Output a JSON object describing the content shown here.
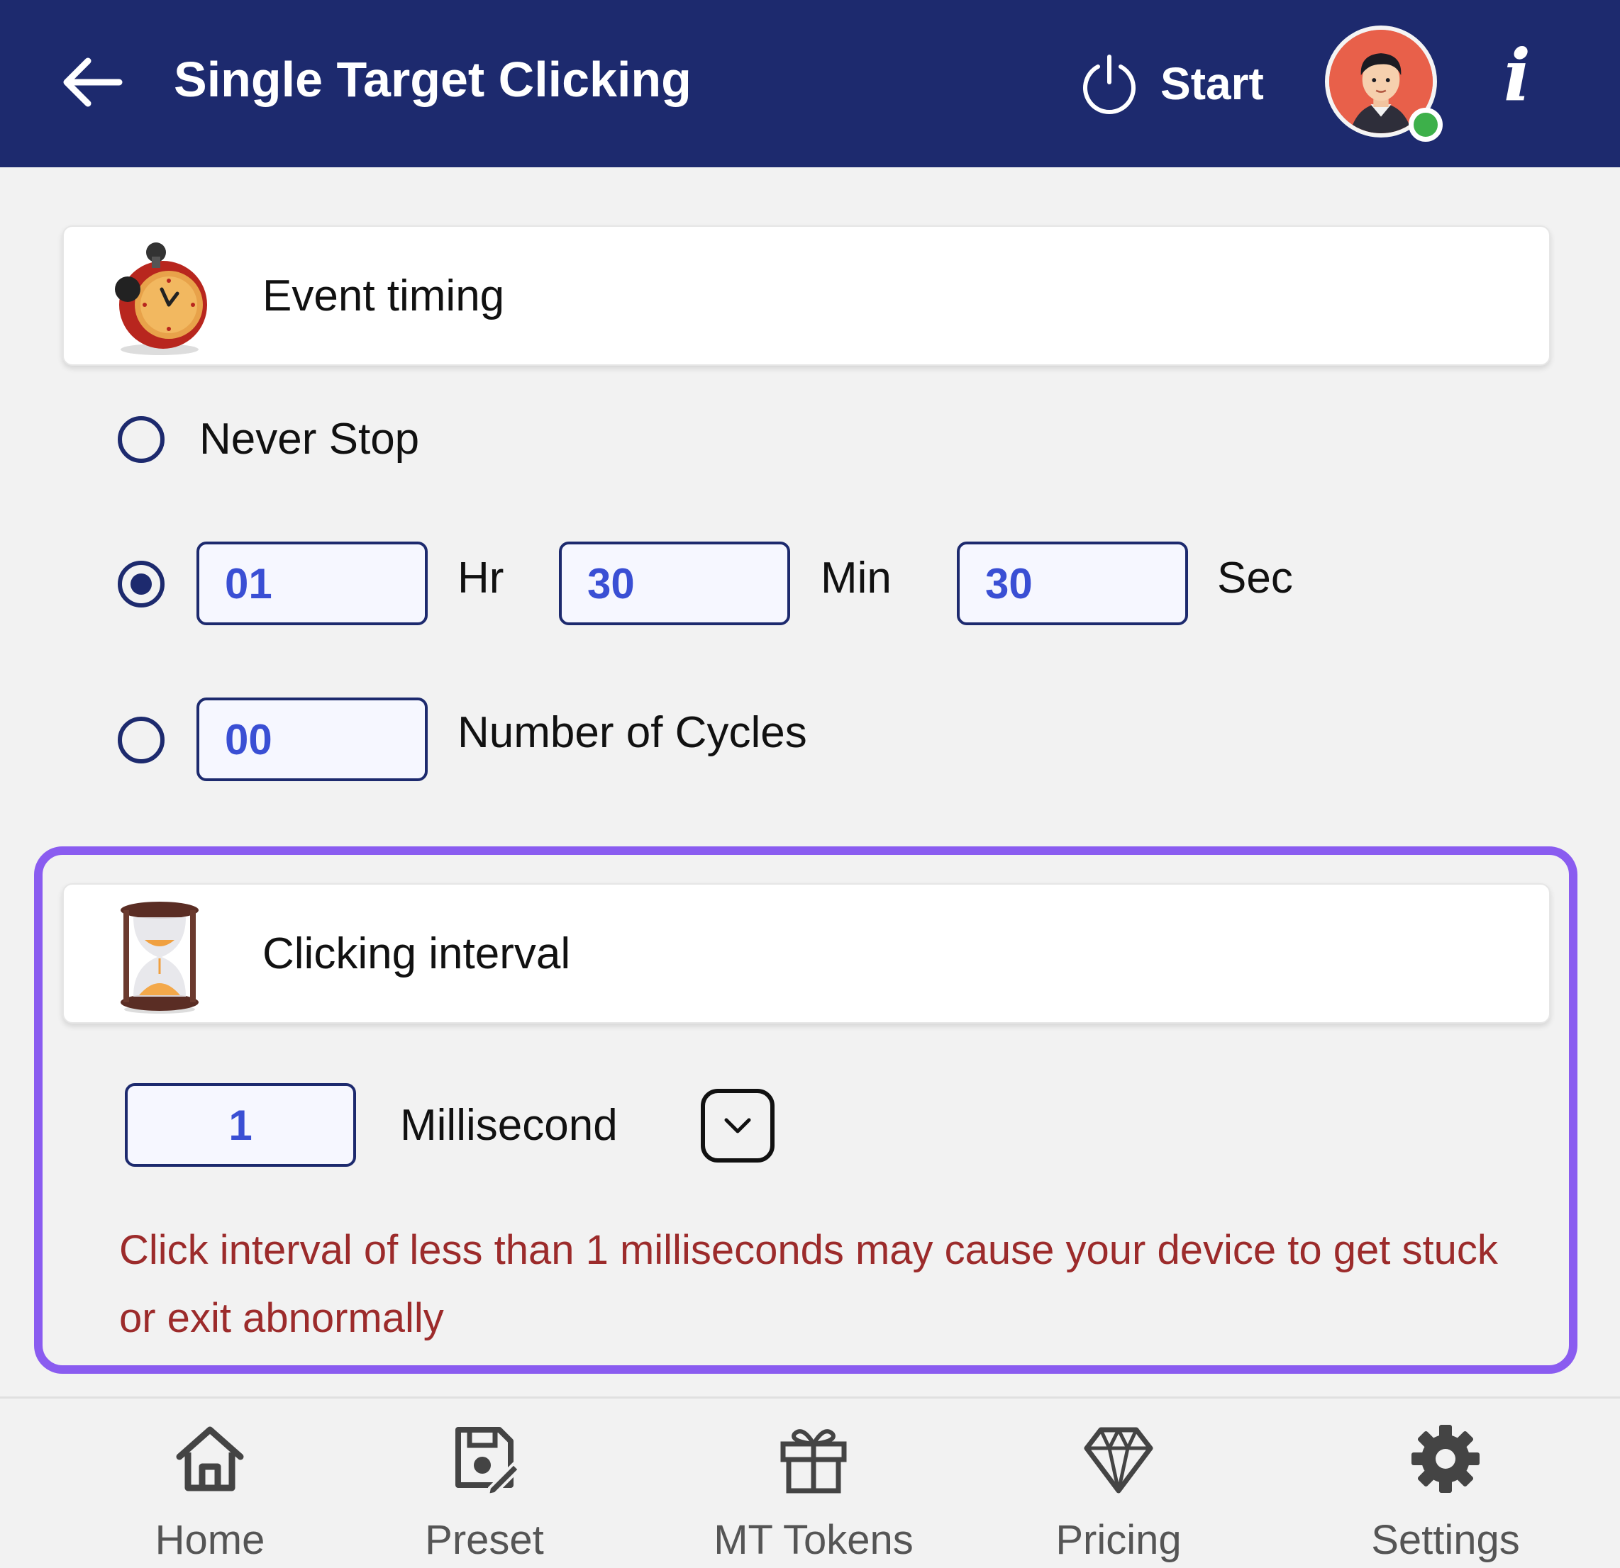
{
  "header": {
    "title": "Single Target Clicking",
    "start_label": "Start",
    "info_label": "i"
  },
  "event_timing": {
    "title": "Event timing",
    "options": {
      "never_stop": {
        "label": "Never Stop",
        "selected": false
      },
      "duration": {
        "selected": true,
        "hours": "01",
        "hours_unit": "Hr",
        "minutes": "30",
        "minutes_unit": "Min",
        "seconds": "30",
        "seconds_unit": "Sec"
      },
      "cycles": {
        "selected": false,
        "value": "00",
        "label": "Number of Cycles"
      }
    }
  },
  "clicking_interval": {
    "title": "Clicking interval",
    "value": "1",
    "unit": "Millisecond",
    "warning": "Click interval of  less than 1 milliseconds may cause your device to get stuck or exit abnormally"
  },
  "nav": {
    "items": [
      {
        "label": "Home",
        "icon": "home-icon"
      },
      {
        "label": "Preset",
        "icon": "preset-icon"
      },
      {
        "label": "MT Tokens",
        "icon": "gift-icon"
      },
      {
        "label": "Pricing",
        "icon": "diamond-icon"
      },
      {
        "label": "Settings",
        "icon": "gear-icon"
      }
    ]
  },
  "colors": {
    "header_bg": "#1d2a6e",
    "accent_purple": "#8a5cf0",
    "field_text": "#3a4fd4",
    "warning_text": "#9c2b2b",
    "online_dot": "#3db04a"
  }
}
